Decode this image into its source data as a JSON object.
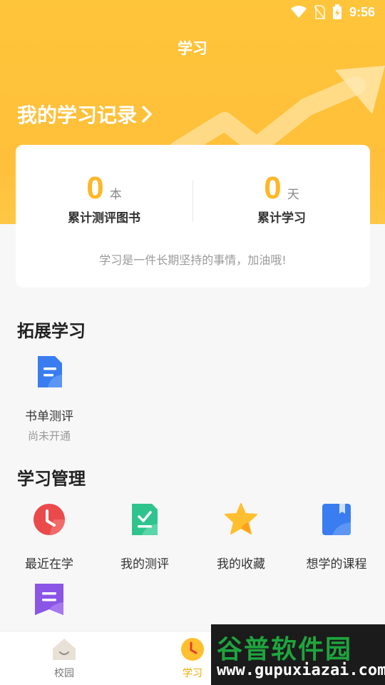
{
  "status_bar": {
    "time": "9:56"
  },
  "header": {
    "title": "学习"
  },
  "record": {
    "title": "我的学习记录"
  },
  "stats": {
    "books": {
      "value": "0",
      "unit": "本",
      "label": "累计测评图书"
    },
    "days": {
      "value": "0",
      "unit": "天",
      "label": "累计学习"
    },
    "tip": "学习是一件长期坚持的事情，加油哦!"
  },
  "extended": {
    "title": "拓展学习",
    "items": [
      {
        "label": "书单测评",
        "sub": "尚未开通",
        "icon": "document-icon"
      }
    ]
  },
  "manage": {
    "title": "学习管理",
    "items": [
      {
        "label": "最近在学",
        "icon": "clock-icon"
      },
      {
        "label": "我的测评",
        "icon": "check-document-icon"
      },
      {
        "label": "我的收藏",
        "icon": "star-icon"
      },
      {
        "label": "想学的课程",
        "icon": "bookmark-book-icon"
      },
      {
        "label": "",
        "icon": "list-bookmark-icon"
      }
    ]
  },
  "tabbar": {
    "items": [
      {
        "label": "校园",
        "icon": "home-icon"
      },
      {
        "label": "学习",
        "icon": "clock-icon",
        "active": true
      }
    ]
  },
  "watermark": {
    "title": "谷普软件园",
    "url": "www.gupuxiazai.com"
  },
  "colors": {
    "accent": "#ffbf3a",
    "stat_number": "#ffb726",
    "active_tab": "#f5a800"
  }
}
